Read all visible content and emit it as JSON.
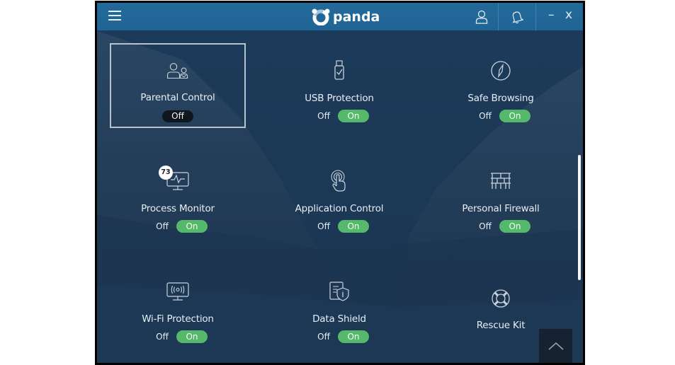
{
  "app": {
    "brand": "panda",
    "brand_color": "#1f6494",
    "accent_on_color": "#55b86a"
  },
  "header": {
    "menu_icon": "hamburger-menu-icon",
    "account_icon": "user-icon",
    "notifications_icon": "bell-icon",
    "minimize_label": "–",
    "close_label": "x"
  },
  "modules": [
    {
      "name": "Parental Control",
      "icon": "parental-control-icon",
      "state": "off",
      "off_label": "Off",
      "on_label": "On",
      "selected": true
    },
    {
      "name": "USB Protection",
      "icon": "usb-shield-icon",
      "state": "on",
      "off_label": "Off",
      "on_label": "On"
    },
    {
      "name": "Safe Browsing",
      "icon": "compass-icon",
      "state": "on",
      "off_label": "Off",
      "on_label": "On"
    },
    {
      "name": "Process Monitor",
      "icon": "monitor-pulse-icon",
      "state": "on",
      "off_label": "Off",
      "on_label": "On",
      "badge": "73"
    },
    {
      "name": "Application Control",
      "icon": "touch-hand-icon",
      "state": "on",
      "off_label": "Off",
      "on_label": "On"
    },
    {
      "name": "Personal Firewall",
      "icon": "firewall-brick-icon",
      "state": "on",
      "off_label": "Off",
      "on_label": "On"
    },
    {
      "name": "Wi-Fi Protection",
      "icon": "wifi-monitor-icon",
      "state": "on",
      "off_label": "Off",
      "on_label": "On"
    },
    {
      "name": "Data Shield",
      "icon": "document-shield-icon",
      "state": "on",
      "off_label": "Off",
      "on_label": "On"
    },
    {
      "name": "Rescue Kit",
      "icon": "lifebuoy-icon"
    }
  ],
  "scroll_to_top_icon": "chevron-up-icon"
}
